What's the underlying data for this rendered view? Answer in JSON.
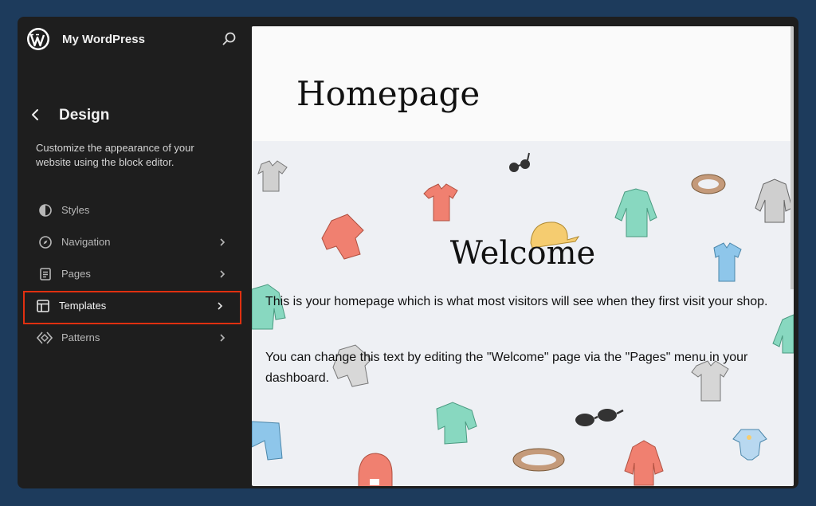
{
  "site": {
    "title": "My WordPress"
  },
  "sidebar": {
    "section_title": "Design",
    "description": "Customize the appearance of your website using the block editor.",
    "items": [
      {
        "label": "Styles",
        "icon": "half-circle-icon",
        "has_chevron": false
      },
      {
        "label": "Navigation",
        "icon": "compass-icon",
        "has_chevron": true
      },
      {
        "label": "Pages",
        "icon": "page-icon",
        "has_chevron": true
      },
      {
        "label": "Templates",
        "icon": "layout-icon",
        "has_chevron": true,
        "highlighted": true
      },
      {
        "label": "Patterns",
        "icon": "diamond-icon",
        "has_chevron": true
      }
    ]
  },
  "canvas": {
    "page_title": "Homepage",
    "welcome_title": "Welcome",
    "paragraphs": [
      "This is your homepage which is what most visitors will see when they first visit your shop.",
      "You can change this text by editing the \"Welcome\" page via the \"Pages\" menu in your dashboard."
    ]
  },
  "colors": {
    "page_background": "#1d3b5c",
    "sidebar_background": "#1e1e1e",
    "highlight_border": "#e03010",
    "canvas_background": "#eef0f4"
  }
}
